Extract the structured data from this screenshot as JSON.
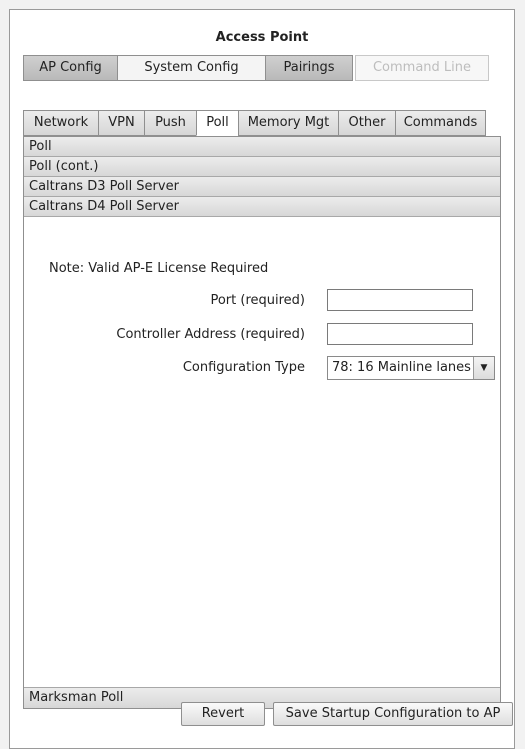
{
  "window": {
    "title": "Access Point"
  },
  "top_tabs": [
    {
      "label": "AP Config"
    },
    {
      "label": "System Config"
    },
    {
      "label": "Pairings"
    },
    {
      "label": "Command Line"
    }
  ],
  "sub_tabs": [
    {
      "label": "Network"
    },
    {
      "label": "VPN"
    },
    {
      "label": "Push"
    },
    {
      "label": "Poll"
    },
    {
      "label": "Memory Mgt"
    },
    {
      "label": "Other"
    },
    {
      "label": "Commands"
    }
  ],
  "sections": [
    {
      "label": "Poll"
    },
    {
      "label": "Poll (cont.)"
    },
    {
      "label": "Caltrans D3 Poll Server"
    },
    {
      "label": "Caltrans D4 Poll Server"
    }
  ],
  "bottom_section": {
    "label": "Marksman Poll"
  },
  "form": {
    "note": "Note: Valid AP-E License Required",
    "port_label": "Port (required)",
    "port_value": "",
    "controller_label": "Controller Address (required)",
    "controller_value": "",
    "config_type_label": "Configuration Type",
    "config_type_value": "78: 16 Mainline lanes"
  },
  "buttons": {
    "revert": "Revert",
    "save": "Save Startup Configuration to AP"
  },
  "icons": {
    "dropdown": "chevron-down-icon"
  }
}
